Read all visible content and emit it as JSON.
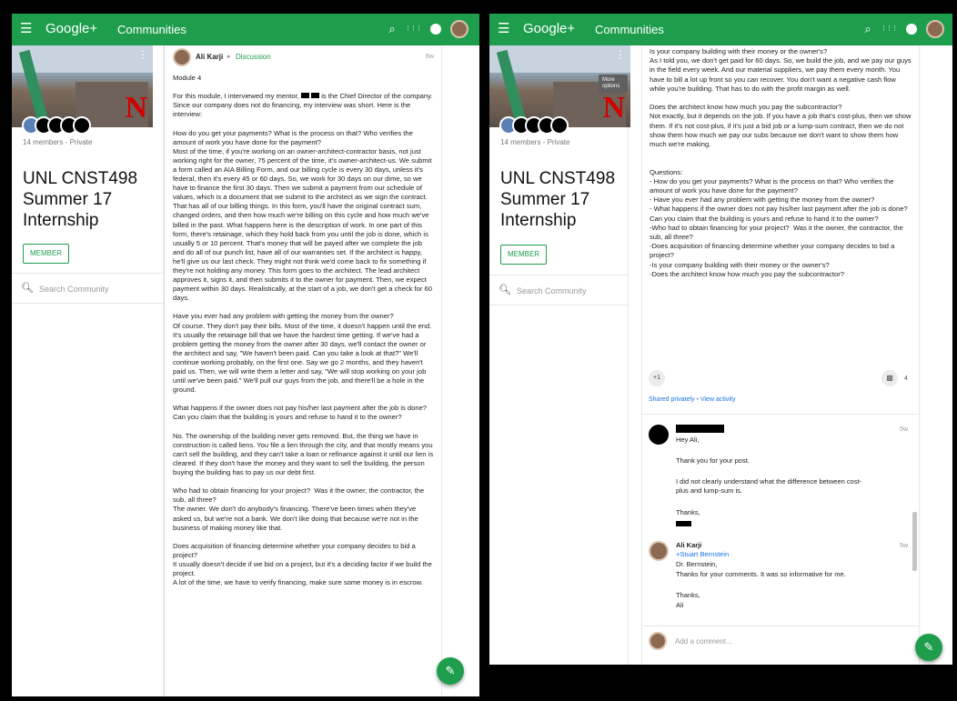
{
  "header": {
    "logo": "Google+",
    "section": "Communities",
    "menu_icon": "☰",
    "search_icon": "⌕",
    "apps_icon": "⋮⋮⋮"
  },
  "community": {
    "members": "14 members - Private",
    "name": "UNL CNST498 Summer 17 Internship",
    "member_button": "MEMBER",
    "search_placeholder": "Search Community",
    "logo_letter": "N",
    "menu_tooltip": "More options"
  },
  "post": {
    "author": "Ali Karji",
    "arrow": "▸",
    "category": "Discussion",
    "time": "6w",
    "left_text_a": "Module 4\n\nFor this module, I interviewed my mentor, ",
    "left_text_b": " is the Chief Director of the company. Since our company does not do financing, my interview was short. Here is the interview:\n\nHow do you get your payments? What is the process on that? Who verifies the amount of work you have done for the payment?\nMost of the time, if you're working on an owner-architect-contractor basis, not just working right for the owner, 75 percent of the time, it's owner-architect-us. We submit a form called an AIA Billing Form, and our billing cycle is every 30 days, unless it's federal, then it's every 45 or 60 days. So, we work for 30 days on our dime, so we have to finance the first 30 days. Then we submit a payment from our schedule of values, which is a document that we submit to the architect as we sign the contract. That has all of our billing things. In this form, you'll have the original contract sum, changed orders, and then how much we're billing on this cycle and how much we've billed in the past. What happens here is the description of work. In one part of this form, there's retainage, which they hold back from you until the job is done, which is usually 5 or 10 percent. That's money that will be payed after we complete the job and do all of our punch list, have all of our warranties set. If the architect is happy, he'll give us our last check. They might not think we'd come back to fix something if they're not holding any money. This form goes to the architect. The lead architect approves it, signs it, and then submits it to the owner for payment. Then, we expect payment within 30 days. Realistically, at the start of a job, we don't get a check for 60 days.\n\nHave you ever had any problem with getting the money from the owner?\nOf course. They don't pay their bills. Most of the time, it doesn't happen until the end. It's usually the retainage bill that we have the hardest time getting. If we've had a problem getting the money from the owner after 30 days, we'll contact the owner or the architect and say, \"We haven't been paid. Can you take a look at that?\" We'll continue working probably, on the first one. Say we go 2 months, and they haven't paid us. Then, we will write them a letter and say, \"We will stop working on your job until we've been paid.\" We'll pull our guys from the job, and there'll be a hole in the ground.\n\nWhat happens if the owner does not pay his/her last payment after the job is done? Can you claim that the building is yours and refuse to hand it to the owner?\n\nNo. The ownership of the building never gets removed. But, the thing we have in construction is called liens. You file a lien through the city, and that mostly means you can't sell the building, and they can't take a loan or refinance against it until our lien is cleared. If they don't have the money and they want to sell the building, the person buying the building has to pay us our debt first.\n\nWho had to obtain financing for your project?  Was it the owner, the contractor, the sub, all three?\nThe owner. We don't do anybody's financing. There've been times when they've asked us, but we're not a bank. We don't like doing that because we're not in the business of making money like that.\n\nDoes acquisition of financing determine whether your company decides to bid a project?\nIt usually doesn't decide if we bid on a project, but it's a deciding factor if we build the project.\nA lot of the time, we have to verify financing, make sure some money is in escrow.",
    "right_text": "Is your company building with their money or the owner's?\nAs I told you, we don't get paid for 60 days. So, we build the job, and we pay our guys in the field every week. And our material suppliers, we pay them every month. You have to bill a lot up front so you can recover. You don't want a negative cash flow while you're building. That has to do with the profit margin as well.\n\nDoes the architect know how much you pay the subcontractor?\nNot exactly, but it depends on the job. If you have a job that's cost-plus, then we show them. If it's not cost-plus, if it's just a bid job or a lump-sum contract, then we do not show them how much we pay our subs because we don't want to show them how much we're making.\n\n\nQuestions:\n- How do you get your payments? What is the process on that? Who verifies the amount of work you have done for the payment?\n- Have you ever had any problem with getting the money from the owner?\n- What happens if the owner does not pay his/her last payment after the job is done? Can you claim that the building is yours and refuse to hand it to the owner?\n-Who had to obtain financing for your project?  Was it the owner, the contractor, the sub, all three?\n-Does acquisition of financing determine whether your company decides to bid a project?\n-Is your company building with their money or the owner's?\n-Does the architect know how much you pay the subcontractor?",
    "plus_one": "+1",
    "comment_count": "4",
    "shared": "Shared privately",
    "dot": "•",
    "view_activity": "View activity"
  },
  "comments": [
    {
      "time": "5w",
      "greeting": "Hey Ali,",
      "line1": "Thank you for your post.",
      "line2": "I did not clearly understand what the difference between cost-plus and lump-sum is.",
      "closing": "Thanks,"
    },
    {
      "author": "Ali Karji",
      "time": "5w",
      "mention": "+Stuart Bernstein",
      "line1": "Dr. Bernstein,",
      "line2": "Thanks for your comments. It was so informative for me.",
      "closing": "Thanks,",
      "signature": "Ali"
    }
  ],
  "add_comment_placeholder": "Add a comment...",
  "fab_icon": "✎",
  "colors": {
    "brand_green": "#1e9e4d",
    "link_blue": "#1a73e8"
  }
}
